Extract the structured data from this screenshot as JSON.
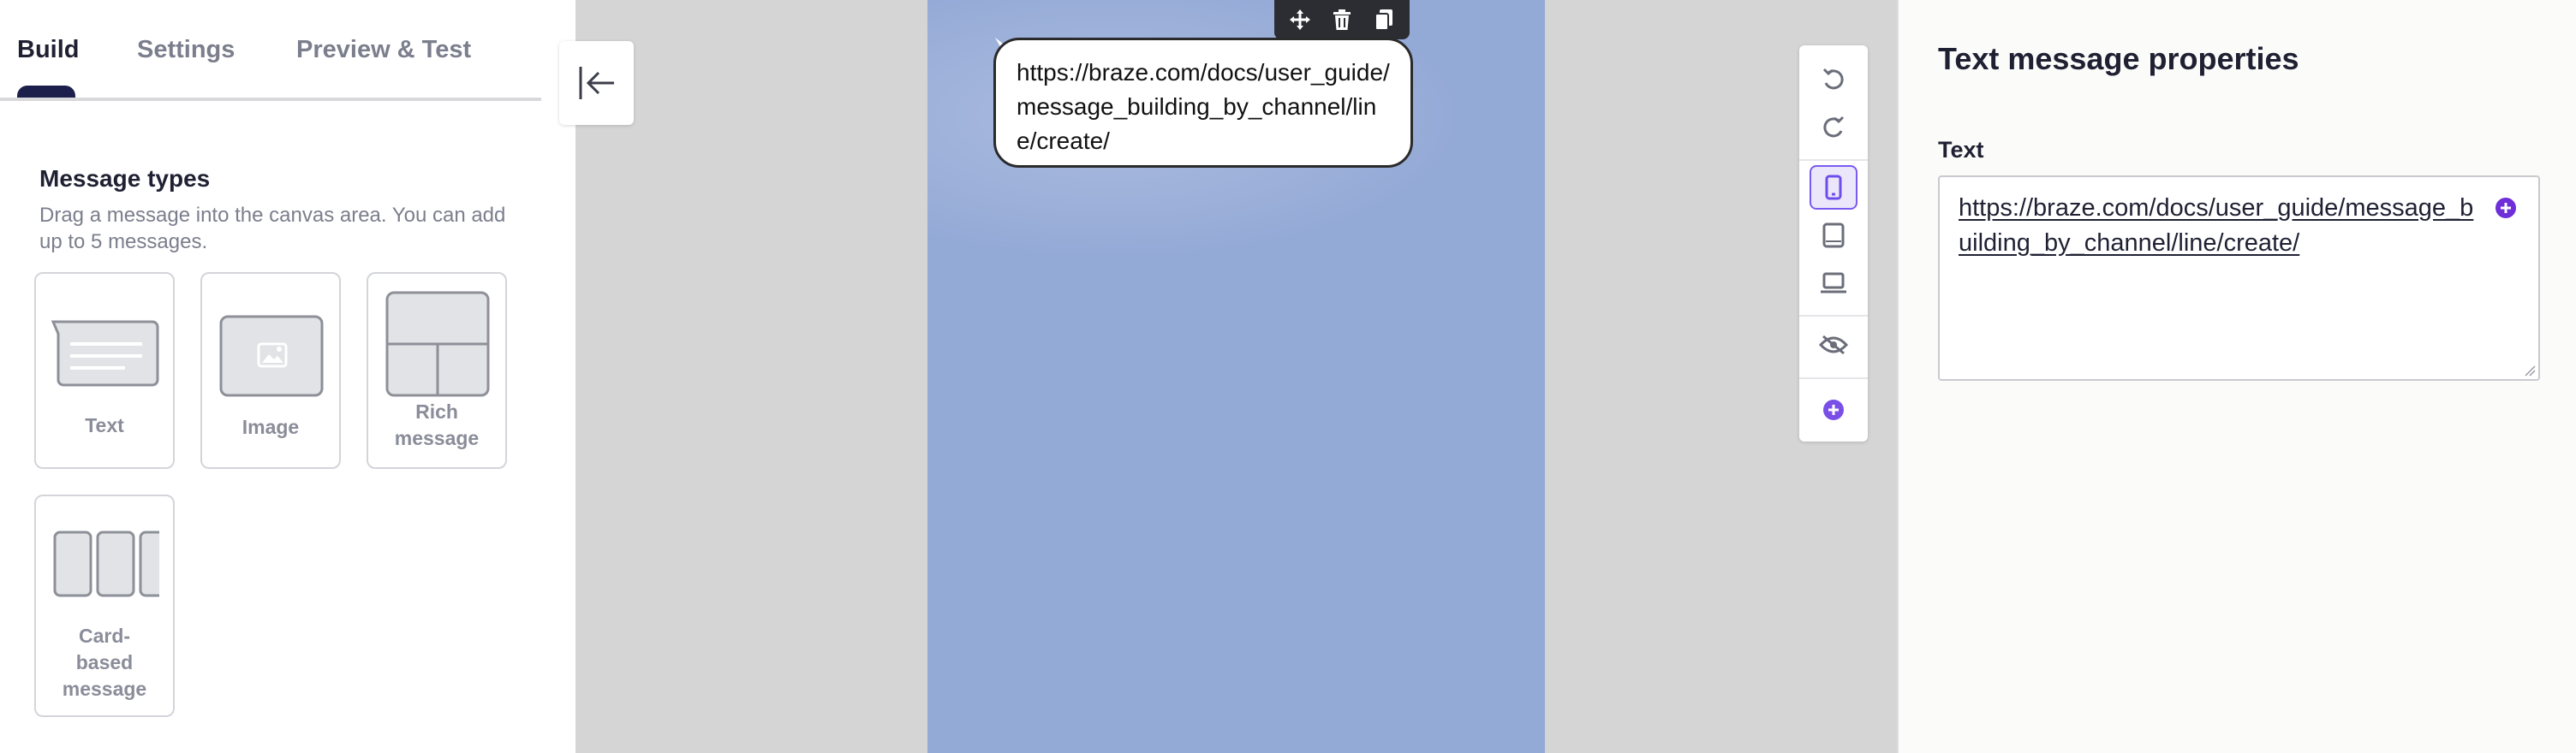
{
  "tabs": [
    {
      "label": "Build",
      "active": true
    },
    {
      "label": "Settings",
      "active": false
    },
    {
      "label": "Preview & Test",
      "active": false
    }
  ],
  "message_types": {
    "title": "Message types",
    "description": "Drag a message into the canvas area. You can add up to 5 messages.",
    "cards": [
      {
        "label": "Text",
        "icon": "text-message-icon"
      },
      {
        "label": "Image",
        "icon": "image-message-icon"
      },
      {
        "label": "Rich message",
        "icon": "rich-message-icon"
      },
      {
        "label": "Card-based message",
        "icon": "card-based-message-icon"
      }
    ]
  },
  "canvas": {
    "bubble_text": "https://braze.com/docs/user_guide/message_building_by_channel/line/create/",
    "message_toolbar": [
      "move-icon",
      "trash-icon",
      "copy-icon"
    ],
    "view_tools": [
      "undo-icon",
      "redo-icon",
      "mobile-view-icon",
      "tablet-view-icon",
      "desktop-view-icon",
      "hide-icon",
      "add-icon"
    ],
    "selected_view": "mobile"
  },
  "properties": {
    "title": "Text message properties",
    "field_label": "Text",
    "field_value": "https://braze.com/docs/user_guide/message_building_by_channel/line/create/"
  },
  "colors": {
    "accent": "#7a5af0",
    "tab_indicator": "#1c1f4b",
    "canvas_bg": "#d5d5d5",
    "phone_bg": "#93a9d6"
  }
}
